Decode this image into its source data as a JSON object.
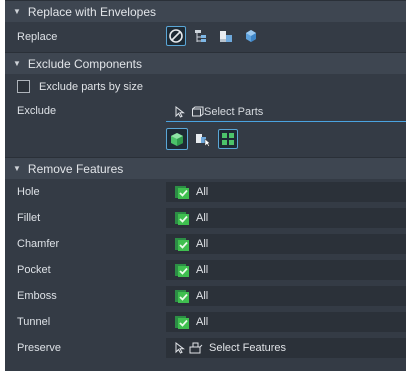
{
  "sections": {
    "replace": {
      "title": "Replace with Envelopes",
      "replace_label": "Replace",
      "icons": [
        "none-icon",
        "tree-structure-icon",
        "assembly-parts-icon",
        "cube-icon"
      ]
    },
    "exclude": {
      "title": "Exclude Components",
      "checkbox_label": "Exclude parts by size",
      "checkbox_checked": false,
      "exclude_label": "Exclude",
      "select_text": "Select Parts",
      "icons": [
        "green-cube-icon",
        "parts-select-icon",
        "grid-icon"
      ]
    },
    "remove": {
      "title": "Remove Features",
      "rows": [
        {
          "label": "Hole",
          "value": "All"
        },
        {
          "label": "Fillet",
          "value": "All"
        },
        {
          "label": "Chamfer",
          "value": "All"
        },
        {
          "label": "Pocket",
          "value": "All"
        },
        {
          "label": "Emboss",
          "value": "All"
        },
        {
          "label": "Tunnel",
          "value": "All"
        }
      ],
      "preserve_label": "Preserve",
      "preserve_text": "Select Features"
    }
  },
  "colors": {
    "panel_bg": "#343b45",
    "header_bg": "#3e4651",
    "field_bg": "#2b3139",
    "accent_blue": "#4aa3e0",
    "check_green": "#3fbf4f"
  }
}
